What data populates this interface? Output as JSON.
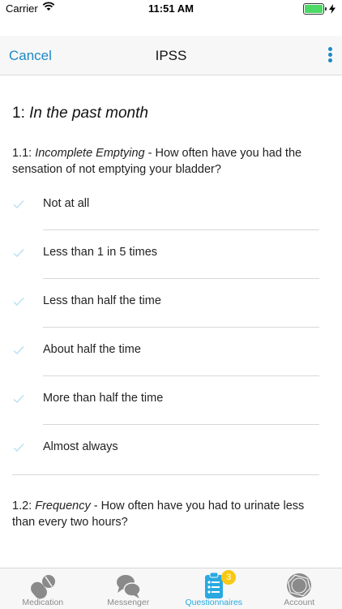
{
  "status_bar": {
    "carrier": "Carrier",
    "time": "11:51 AM",
    "battery_level": 1.0
  },
  "nav": {
    "cancel_label": "Cancel",
    "title": "IPSS",
    "menu_icon": "more-vertical-icon"
  },
  "section": {
    "number": "1:",
    "title": "In the past month"
  },
  "questions": [
    {
      "number": "1.1:",
      "name": "Incomplete Emptying",
      "text": "- How often have you had the sensation of not emptying your bladder?",
      "options": [
        "Not at all",
        "Less than 1 in 5 times",
        "Less than half the time",
        "About half the time",
        "More than half the time",
        "Almost always"
      ]
    },
    {
      "number": "1.2:",
      "name": "Frequency",
      "text": "- How often have you had to urinate less than every two hours?"
    }
  ],
  "tabs": [
    {
      "label": "Medication",
      "icon": "pills-icon"
    },
    {
      "label": "Messenger",
      "icon": "chat-bubbles-icon"
    },
    {
      "label": "Questionnaires",
      "icon": "clipboard-list-icon",
      "badge": "3",
      "active": true
    },
    {
      "label": "Account",
      "icon": "account-icon"
    }
  ],
  "colors": {
    "accent": "#1e88c7",
    "active_tab": "#29a9e0",
    "badge": "#f7c814",
    "check": "#b9dff3"
  }
}
